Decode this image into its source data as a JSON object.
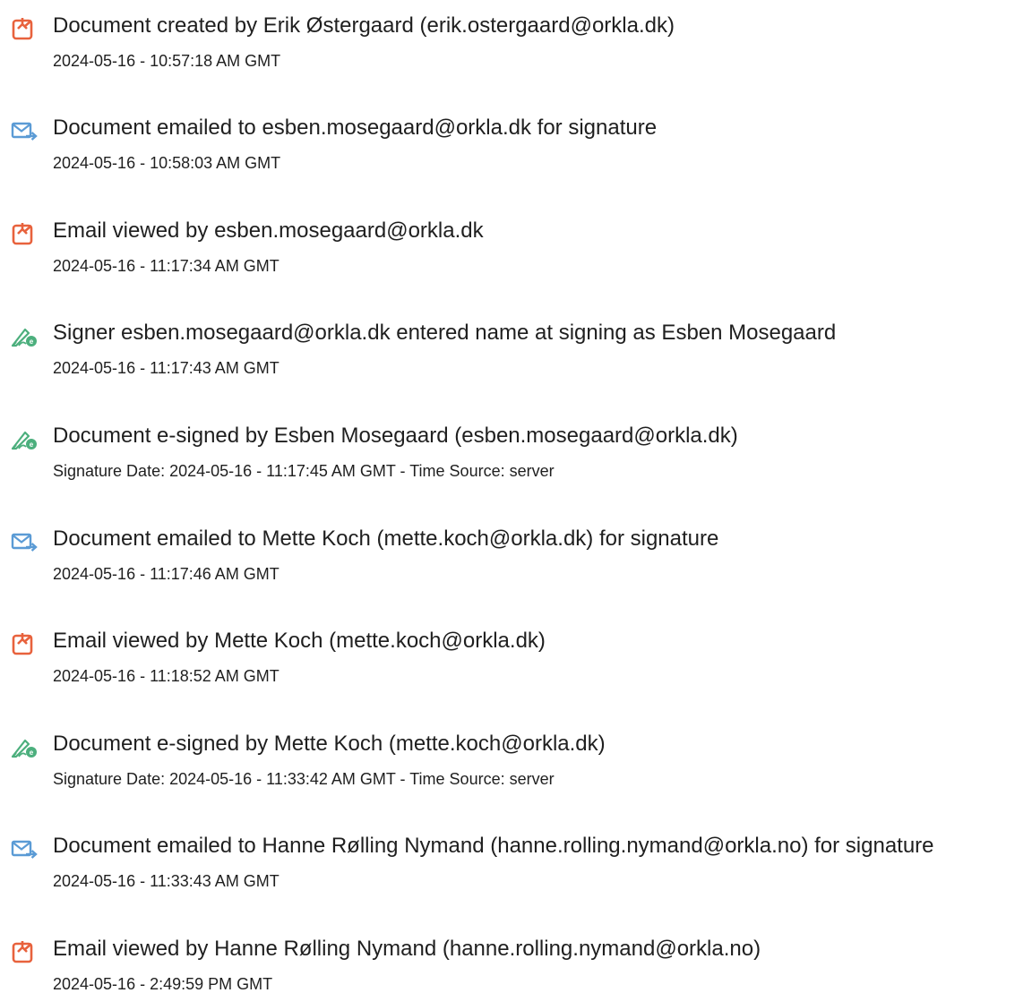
{
  "colors": {
    "doc_icon": "#e8623d",
    "mail_icon": "#5b9bd5",
    "sign_icon": "#4caf7d",
    "text": "#1f1f1f"
  },
  "events": [
    {
      "icon": "document-icon",
      "title": "Document created by Erik Østergaard (erik.ostergaard@orkla.dk)",
      "timestamp": "2024-05-16 - 10:57:18 AM GMT"
    },
    {
      "icon": "email-sent-icon",
      "title": "Document emailed to esben.mosegaard@orkla.dk for signature",
      "timestamp": "2024-05-16 - 10:58:03 AM GMT"
    },
    {
      "icon": "document-icon",
      "title": "Email viewed by esben.mosegaard@orkla.dk",
      "timestamp": "2024-05-16 - 11:17:34 AM GMT"
    },
    {
      "icon": "e-sign-icon",
      "title": "Signer esben.mosegaard@orkla.dk entered name at signing as Esben Mosegaard",
      "timestamp": "2024-05-16 - 11:17:43 AM GMT"
    },
    {
      "icon": "e-sign-icon",
      "title": "Document e-signed by Esben Mosegaard (esben.mosegaard@orkla.dk)",
      "timestamp": "Signature Date: 2024-05-16 - 11:17:45 AM GMT - Time Source: server"
    },
    {
      "icon": "email-sent-icon",
      "title": "Document emailed to Mette Koch (mette.koch@orkla.dk) for signature",
      "timestamp": "2024-05-16 - 11:17:46 AM GMT"
    },
    {
      "icon": "document-icon",
      "title": "Email viewed by Mette Koch (mette.koch@orkla.dk)",
      "timestamp": "2024-05-16 - 11:18:52 AM GMT"
    },
    {
      "icon": "e-sign-icon",
      "title": "Document e-signed by Mette Koch (mette.koch@orkla.dk)",
      "timestamp": "Signature Date: 2024-05-16 - 11:33:42 AM GMT - Time Source: server"
    },
    {
      "icon": "email-sent-icon",
      "title": "Document emailed to Hanne Rølling Nymand (hanne.rolling.nymand@orkla.no) for signature",
      "timestamp": "2024-05-16 - 11:33:43 AM GMT"
    },
    {
      "icon": "document-icon",
      "title": "Email viewed by Hanne Rølling Nymand (hanne.rolling.nymand@orkla.no)",
      "timestamp": "2024-05-16 - 2:49:59 PM GMT"
    }
  ]
}
